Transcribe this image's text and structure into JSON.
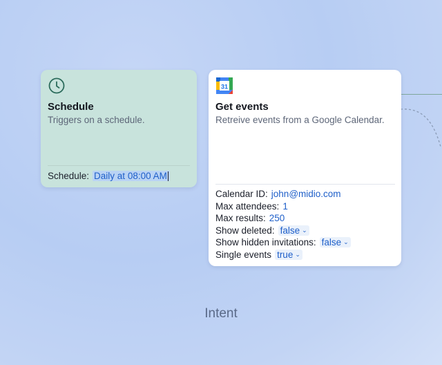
{
  "schedule_node": {
    "icon": "clock-icon",
    "title": "Schedule",
    "subtitle": "Triggers on a schedule.",
    "property_label": "Schedule:",
    "property_value": "Daily at 08:00 AM"
  },
  "events_node": {
    "icon": "google-calendar-icon",
    "icon_text": "31",
    "title": "Get events",
    "subtitle": "Retreive events from a Google Calendar.",
    "properties": [
      {
        "label": "Calendar ID:",
        "value": "john@midio.com"
      },
      {
        "label": "Max attendees:",
        "value": "1"
      },
      {
        "label": "Max results:",
        "value": "250"
      },
      {
        "label": "Show deleted:",
        "value": "false"
      },
      {
        "label": "Show hidden invitations:",
        "value": "false"
      },
      {
        "label": "Single events",
        "value": "true"
      }
    ]
  },
  "footer": {
    "label": "Intent"
  },
  "colors": {
    "accent": "#1e5fc9",
    "schedule_bg": "#c8e3dc",
    "connector": "#7fa79b"
  }
}
